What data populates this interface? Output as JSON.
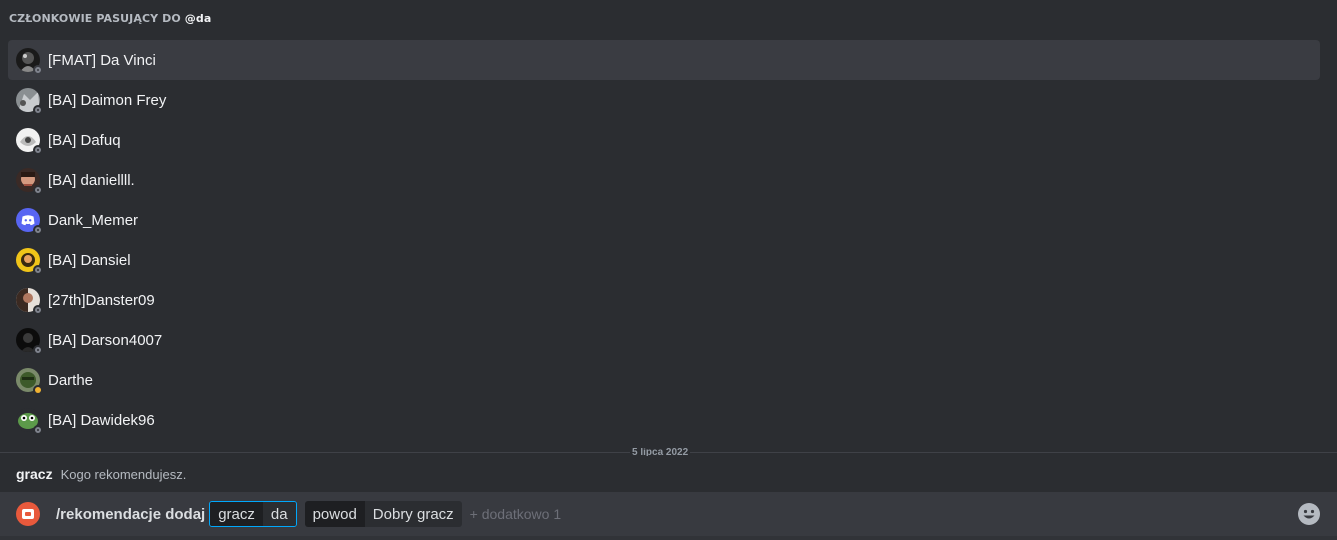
{
  "autocomplete": {
    "header_prefix": "CZŁONKOWIE PASUJĄCY DO",
    "header_query": "@da",
    "members": [
      {
        "name": "[FMAT] Da Vinci",
        "avatar": "avatar-dark-icon",
        "status": "offline",
        "selected": true
      },
      {
        "name": "[BA] Daimon Frey",
        "avatar": "avatar-grey-icon",
        "status": "offline",
        "selected": false
      },
      {
        "name": "[BA] Dafuq",
        "avatar": "avatar-white-icon",
        "status": "offline",
        "selected": false
      },
      {
        "name": "[BA] daniellll.",
        "avatar": "avatar-face-icon",
        "status": "offline",
        "selected": false
      },
      {
        "name": "Dank_Memer",
        "avatar": "discord-logo-icon",
        "status": "offline",
        "selected": false
      },
      {
        "name": "[BA] Dansiel",
        "avatar": "avatar-yellow-icon",
        "status": "offline",
        "selected": false
      },
      {
        "name": "[27th]Danster09",
        "avatar": "avatar-brown-icon",
        "status": "offline",
        "selected": false
      },
      {
        "name": "[BA] Darson4007",
        "avatar": "avatar-black-icon",
        "status": "offline",
        "selected": false
      },
      {
        "name": "Darthe",
        "avatar": "avatar-green-icon",
        "status": "idle",
        "selected": false
      },
      {
        "name": "[BA] Dawidek96",
        "avatar": "avatar-frog-icon",
        "status": "offline",
        "selected": false
      }
    ]
  },
  "date_divider": "5 lipca 2022",
  "option_hint": {
    "name": "gracz",
    "description": "Kogo rekomendujesz."
  },
  "command_bar": {
    "command": "/rekomendacje dodaj",
    "options": [
      {
        "key": "gracz",
        "value": "da",
        "active": true
      },
      {
        "key": "powod",
        "value": "Dobry gracz",
        "active": false
      }
    ],
    "extra": "+ dodatkowo 1"
  },
  "colors": {
    "accent": "#00a8fc",
    "idle": "#f0b232",
    "blurple": "#5865f2",
    "app_icon": "#e8593c"
  }
}
